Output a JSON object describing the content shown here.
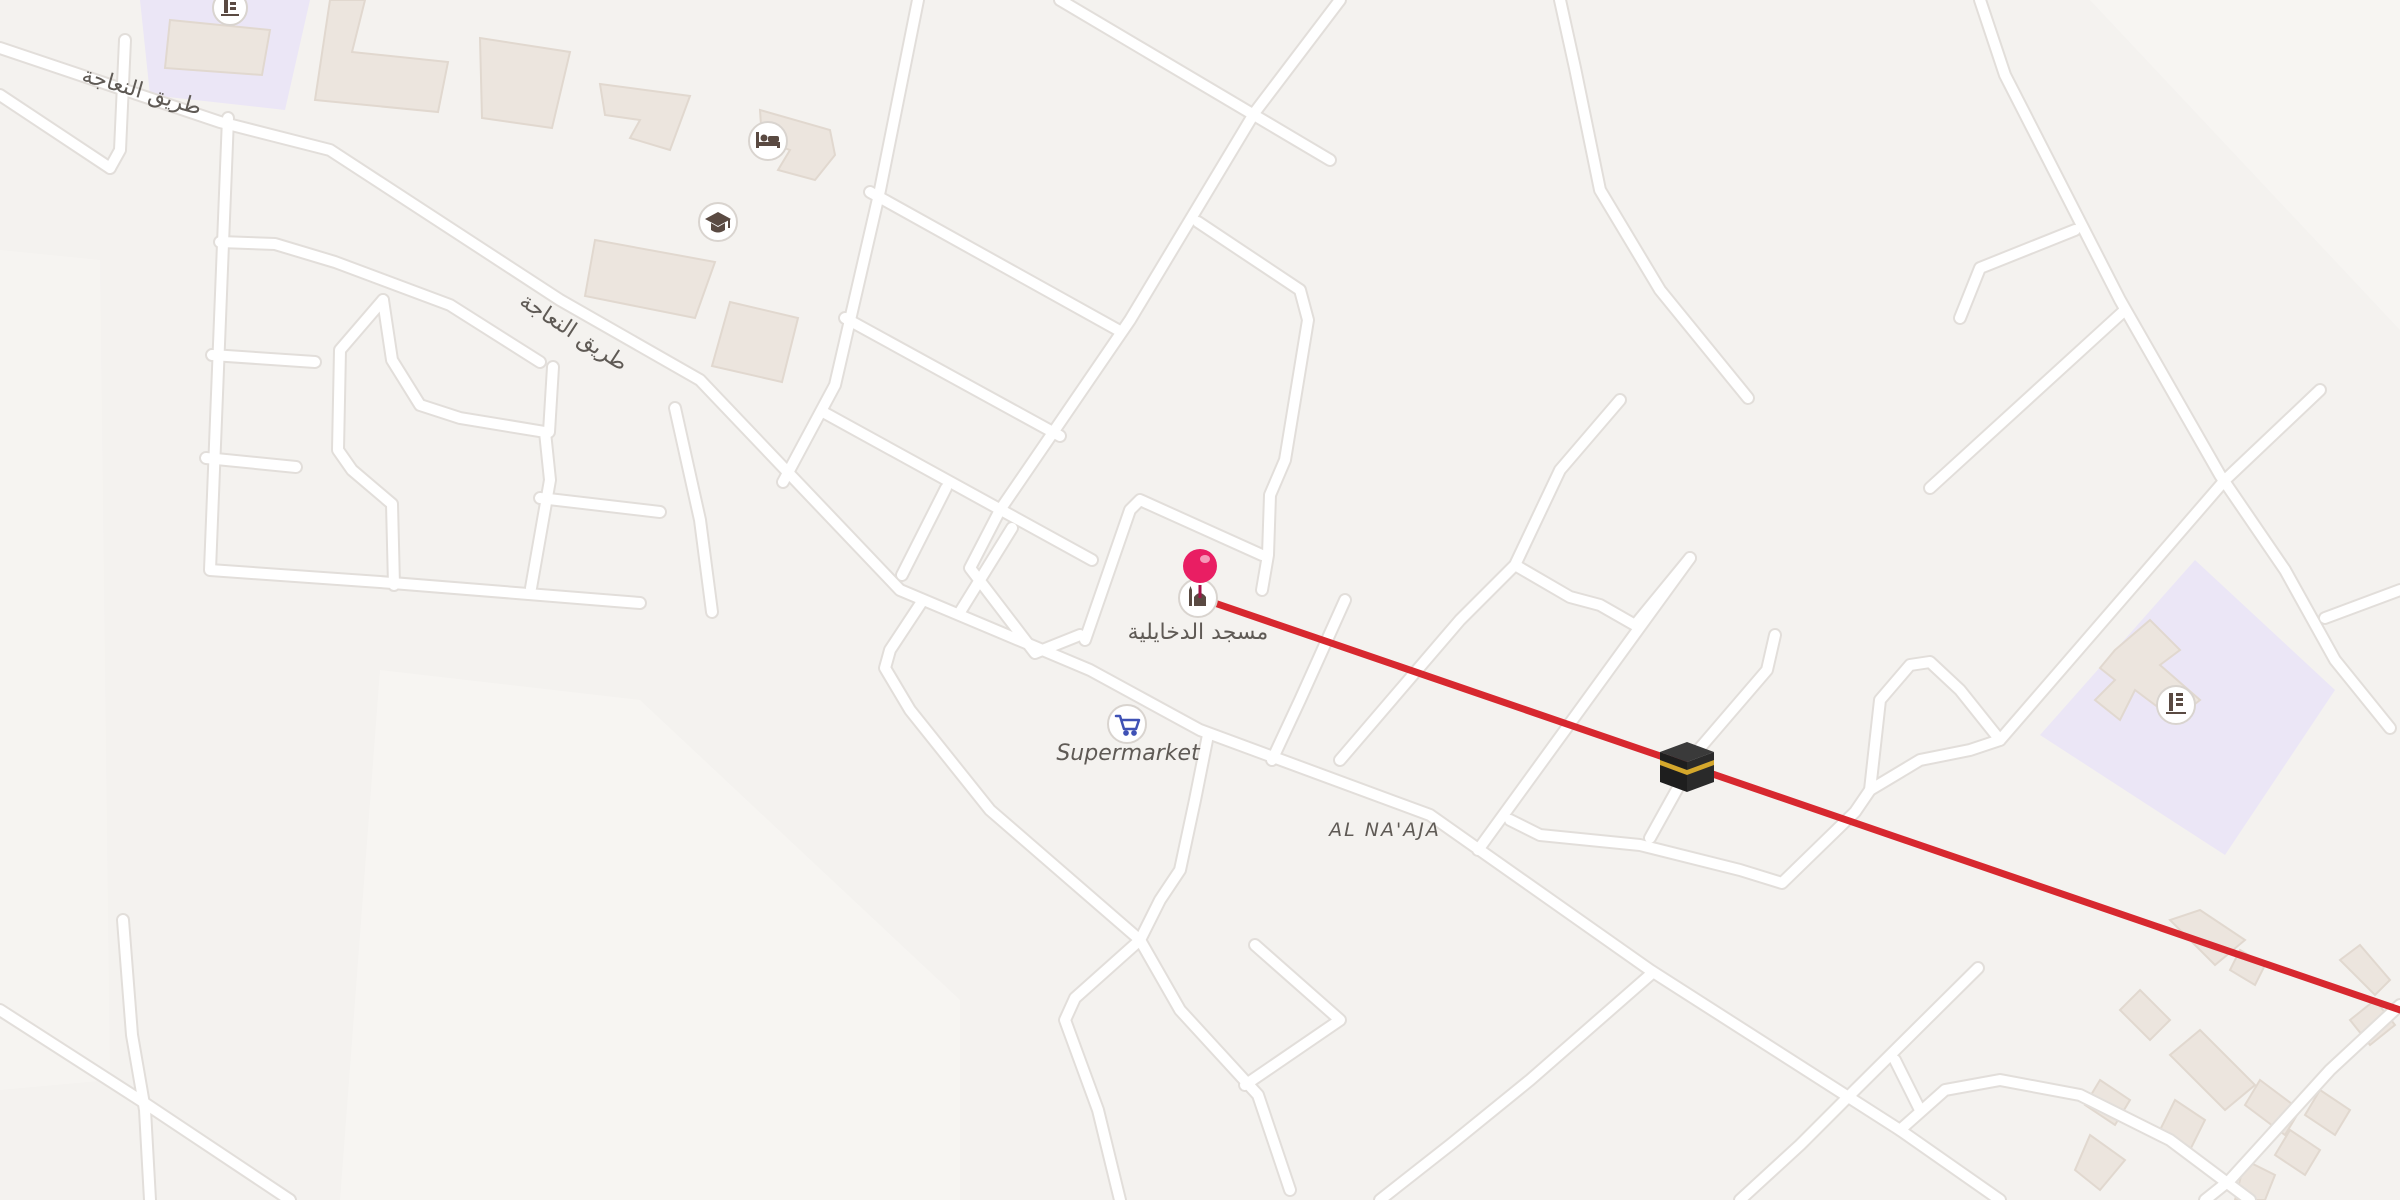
{
  "map": {
    "colors": {
      "background": "#f4f2ef",
      "road": "#ffffff",
      "road_casing": "#e2deda",
      "building": "#ece5de",
      "landuse_school": "#ebe6f6",
      "route": "#d7282f",
      "pin": "#e91e63",
      "poi_icon": "#5a4a42",
      "supermarket_icon": "#3f51b5"
    },
    "labels": {
      "road_top_left": "طريق النعاجة",
      "road_middle": "طريق النعاجة",
      "district": "AL NA'AJA",
      "mosque": "مسجد الدخايلية",
      "supermarket": "Supermarket"
    },
    "pois": [
      {
        "kind": "school",
        "icon": "school-icon"
      },
      {
        "kind": "hotel",
        "icon": "bed-icon"
      },
      {
        "kind": "university",
        "icon": "graduation-cap-icon"
      },
      {
        "kind": "mosque",
        "icon": "mosque-icon"
      },
      {
        "kind": "supermarket",
        "icon": "shopping-cart-icon"
      },
      {
        "kind": "school",
        "icon": "school-icon"
      }
    ],
    "route": {
      "destination_icon": "kaaba-icon",
      "origin_marker": "location-pin"
    }
  }
}
